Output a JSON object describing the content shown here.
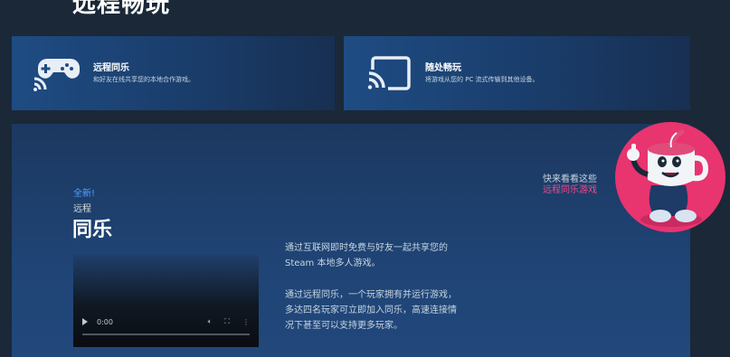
{
  "page": {
    "title": "远程畅玩"
  },
  "cards": [
    {
      "title": "远程同乐",
      "desc": "和好友在线共享您的本地合作游戏。",
      "icon": "gamepad-cast-icon"
    },
    {
      "title": "随处畅玩",
      "desc": "将游戏从您的 PC 流式传输到其他设备。",
      "icon": "screen-cast-icon"
    }
  ],
  "feature": {
    "badge": "全新!",
    "sub": "远程",
    "title": "同乐",
    "desc1": "通过互联网即时免费与好友一起共享您的 Steam 本地多人游戏。",
    "desc2": "通过远程同乐，一个玩家拥有并运行游戏，多达四名玩家可立即加入同乐，高速连接情况下甚至可以支持更多玩家。"
  },
  "video": {
    "time": "0:00",
    "progress": 0
  },
  "promo": {
    "line1": "快来看看这些",
    "line2": "远程同乐游戏"
  },
  "colors": {
    "accent": "#4fa3ff",
    "promo": "#f04b8c",
    "background": "#1b2838"
  }
}
